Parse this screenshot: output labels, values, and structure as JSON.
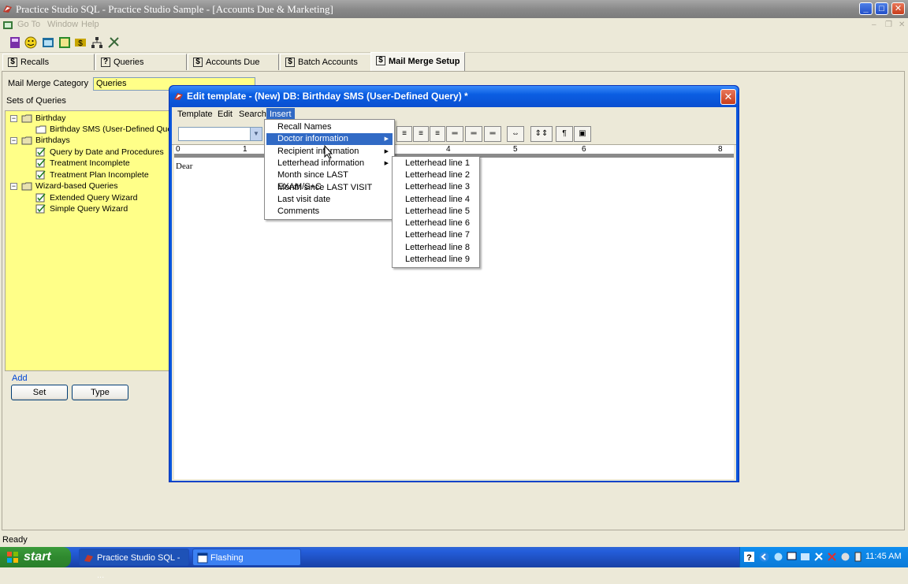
{
  "window": {
    "title": "Practice Studio SQL - Practice Studio Sample - [Accounts Due & Marketing]",
    "menu": [
      "Go To",
      "Window",
      "Help"
    ]
  },
  "tabs": [
    "Recalls",
    "Queries",
    "Accounts Due",
    "Batch Accounts",
    "Mail Merge Setup"
  ],
  "left": {
    "category_label": "Mail Merge Category",
    "category_value": "Queries",
    "sets_label": "Sets of Queries",
    "tree": {
      "g1": "Birthday",
      "g1c1": "Birthday SMS (User-Defined Query)",
      "g2": "Birthdays",
      "g2c1": "Query by Date and Procedures",
      "g2c2": "Treatment Incomplete",
      "g2c3": "Treatment Plan Incomplete",
      "g3": "Wizard-based Queries",
      "g3c1": "Extended Query Wizard",
      "g3c2": "Simple Query Wizard"
    },
    "add_label": "Add",
    "set_button": "Set",
    "type_button": "Type"
  },
  "dialog": {
    "title": "Edit template - (New) DB: Birthday SMS (User-Defined Query) *",
    "menu": [
      "Template",
      "Edit",
      "Search",
      "Insert"
    ],
    "ruler": [
      "0",
      "1",
      "4",
      "5",
      "6",
      "8"
    ],
    "editor_text": "Dear",
    "insert_menu": [
      "Recall Names",
      "Doctor information",
      "Recipient information",
      "Letterhead information",
      "Month since  LAST EXAM/S+C",
      "Month since  LAST VISIT",
      "Last visit date",
      "Comments"
    ],
    "letterhead_menu": [
      "Letterhead line 1",
      "Letterhead line 2",
      "Letterhead line 3",
      "Letterhead line 4",
      "Letterhead line 5",
      "Letterhead line 6",
      "Letterhead line 7",
      "Letterhead line 8",
      "Letterhead line 9"
    ]
  },
  "status": "Ready",
  "taskbar": {
    "start": "start",
    "task1": "Practice Studio SQL - ...",
    "task2": "Flashing",
    "clock": "11:45 AM"
  }
}
